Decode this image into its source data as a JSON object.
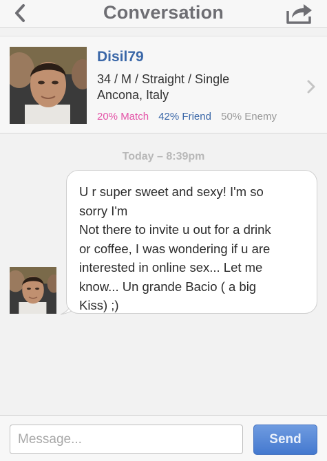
{
  "navbar": {
    "title": "Conversation",
    "back_icon": "chevron-left-icon",
    "share_icon": "share-icon"
  },
  "profile": {
    "username": "Disil79",
    "details": "34 / M / Straight / Single",
    "location": "Ancona, Italy",
    "match": "20% Match",
    "friend": "42% Friend",
    "enemy": "50% Enemy",
    "colors": {
      "match": "#e353a7",
      "friend": "#3a67a8",
      "enemy": "#999999"
    }
  },
  "thread": {
    "timestamp": "Today – 8:39pm",
    "messages": [
      {
        "lines": [
          "U r super sweet and sexy! I'm so",
          "sorry I'm",
          "Not there to invite u out for a drink",
          "or coffee, I was wondering if u are",
          "interested in online sex... Let me",
          "know... Un grande Bacio ( a big",
          "Kiss) ;)"
        ]
      }
    ]
  },
  "composer": {
    "placeholder": "Message...",
    "value": "",
    "send_label": "Send",
    "accent": "#4a7fd4"
  }
}
